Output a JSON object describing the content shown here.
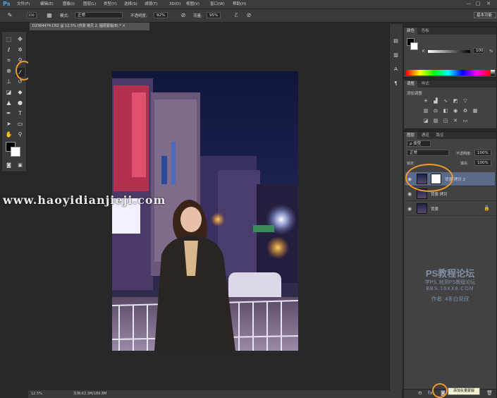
{
  "menubar": {
    "logo": "Ps",
    "items": [
      "文件(F)",
      "编辑(E)",
      "图像(I)",
      "图层(L)",
      "类型(Y)",
      "选择(S)",
      "滤镜(T)",
      "3D(D)",
      "视图(V)",
      "窗口(W)",
      "帮助(H)"
    ],
    "window_buttons": [
      "—",
      "□",
      "✕"
    ]
  },
  "options": {
    "brush_size": "150",
    "mode_label": "模式:",
    "mode_value": "正常",
    "opacity_label": "不透明度:",
    "opacity_value": "92%",
    "flow_label": "流量:",
    "flow_value": "95%",
    "workspace": "基本功能"
  },
  "document": {
    "tab_title": "D2364474.CR2 @ 12.5% (背景 拷贝 2, 图层蒙版/8) * ×",
    "zoom": "12.5%",
    "doc_size": "文档:63.3M/189.8M"
  },
  "watermark": {
    "url": "www.haoyidianjieji.com"
  },
  "color_panel": {
    "tabs": [
      "颜色",
      "色板"
    ],
    "k_label": "K",
    "k_value": "100",
    "k_unit": "%"
  },
  "adjust_panel": {
    "tabs": [
      "调整",
      "样式"
    ],
    "title": "添加调整"
  },
  "layers_panel": {
    "tabs": [
      "图层",
      "通道",
      "路径"
    ],
    "filter": "ρ 类型",
    "blend_mode": "正常",
    "opacity_label": "不透明度:",
    "opacity_value": "100%",
    "lock_label": "锁定:",
    "fill_label": "填充:",
    "fill_value": "100%",
    "layers": [
      {
        "name": "背景 拷贝 2"
      },
      {
        "name": "背景 拷贝"
      },
      {
        "name": "背景"
      }
    ],
    "tooltip": "添加矢量蒙版"
  },
  "forum_watermark": {
    "title": "PS教程论坛",
    "line1": "学PS, 就到PS教程论坛",
    "line2": "BBS.16XX8.COM",
    "line3": "作者: 4禾白叔叔"
  },
  "colors": {
    "highlight": "#f29a2e",
    "ps_blue": "#4aa3e8"
  }
}
